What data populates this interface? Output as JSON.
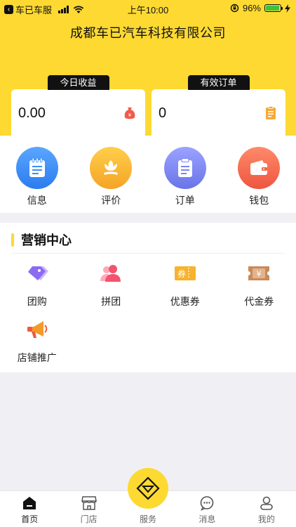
{
  "status_bar": {
    "back_app": "车已车服",
    "time": "上午10:00",
    "battery_text": "96%",
    "battery_level": 0.96
  },
  "header": {
    "company_name": "成都车已汽车科技有限公司"
  },
  "stats": {
    "today_income": {
      "label": "今日收益",
      "value": "0.00"
    },
    "valid_orders": {
      "label": "有效订单",
      "value": "0"
    }
  },
  "quick_actions": [
    {
      "label": "信息",
      "icon": "notebook-icon",
      "color": "#3a8ef6"
    },
    {
      "label": "评价",
      "icon": "flower-icon",
      "color": "#f6b63a"
    },
    {
      "label": "订单",
      "icon": "clipboard-icon",
      "color": "#7b86f0"
    },
    {
      "label": "钱包",
      "icon": "wallet-icon",
      "color": "#f2674b"
    }
  ],
  "marketing": {
    "title": "营销中心",
    "items": [
      {
        "label": "团购",
        "icon": "tag-icon"
      },
      {
        "label": "拼团",
        "icon": "group-users-icon"
      },
      {
        "label": "优惠券",
        "icon": "coupon-icon",
        "icon_text": "券"
      },
      {
        "label": "代金券",
        "icon": "voucher-icon",
        "icon_text": "¥"
      },
      {
        "label": "店铺推广",
        "icon": "megaphone-icon"
      }
    ]
  },
  "tabbar": {
    "items": [
      {
        "label": "首页",
        "icon": "home-icon"
      },
      {
        "label": "门店",
        "icon": "store-icon"
      },
      {
        "label": "服务",
        "icon": "diamond-icon"
      },
      {
        "label": "消息",
        "icon": "message-icon"
      },
      {
        "label": "我的",
        "icon": "user-icon"
      }
    ]
  },
  "colors": {
    "brand_yellow": "#fdd932",
    "background": "#f0f0f4"
  }
}
